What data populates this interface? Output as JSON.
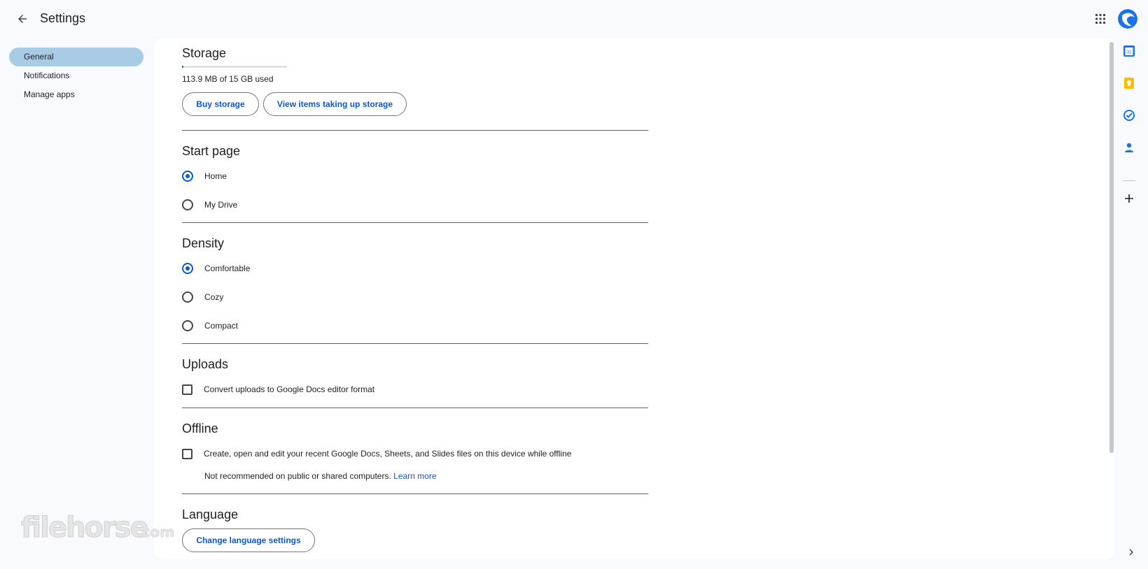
{
  "header": {
    "title": "Settings",
    "back_icon": "arrow-back-icon",
    "apps_icon": "apps-grid-icon",
    "avatar_icon": "account-avatar-icon"
  },
  "nav": {
    "items": [
      {
        "label": "General",
        "active": true
      },
      {
        "label": "Notifications",
        "active": false
      },
      {
        "label": "Manage apps",
        "active": false
      }
    ]
  },
  "storage": {
    "heading": "Storage",
    "usage_text": "113.9 MB of 15 GB used",
    "usage_fraction": 0.0074,
    "buy_label": "Buy storage",
    "view_label": "View items taking up storage"
  },
  "start_page": {
    "heading": "Start page",
    "options": [
      {
        "label": "Home",
        "selected": true
      },
      {
        "label": "My Drive",
        "selected": false
      }
    ]
  },
  "density": {
    "heading": "Density",
    "options": [
      {
        "label": "Comfortable",
        "selected": true
      },
      {
        "label": "Cozy",
        "selected": false
      },
      {
        "label": "Compact",
        "selected": false
      }
    ]
  },
  "uploads": {
    "heading": "Uploads",
    "checkbox_label": "Convert uploads to Google Docs editor format",
    "checked": false
  },
  "offline": {
    "heading": "Offline",
    "checkbox_label": "Create, open and edit your recent Google Docs, Sheets, and Slides files on this device while offline",
    "checked": false,
    "note": "Not recommended on public or shared computers.",
    "learn_more": "Learn more"
  },
  "language": {
    "heading": "Language",
    "button_label": "Change language settings"
  },
  "side_rail": {
    "icons": [
      "calendar-icon",
      "keep-icon",
      "tasks-icon",
      "contacts-icon",
      "add-icon"
    ],
    "calendar_day": "31"
  },
  "watermark": {
    "text": "filehorse.com"
  },
  "colors": {
    "accent": "#0b57d0",
    "nav_active": "#a8cbe6",
    "background": "#f8fafd"
  }
}
